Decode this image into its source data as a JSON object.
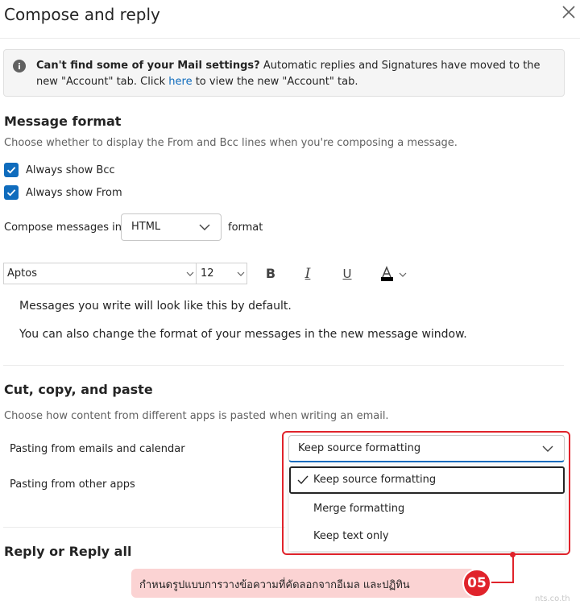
{
  "panel": {
    "title": "Compose and reply",
    "close_icon": "close-icon"
  },
  "info_bar": {
    "bold": "Can't find some of your Mail settings?",
    "text1": " Automatic replies and Signatures have moved to the new \"Account\" tab. Click ",
    "link": "here",
    "text2": " to view the new \"Account\" tab."
  },
  "message_format": {
    "heading": "Message format",
    "description": "Choose whether to display the From and Bcc lines when you're composing a message.",
    "always_bcc": {
      "label": "Always show Bcc",
      "checked": true
    },
    "always_from": {
      "label": "Always show From",
      "checked": true
    },
    "compose_prefix": "Compose messages in",
    "compose_value": "HTML",
    "compose_suffix": "format",
    "font_name": "Aptos",
    "font_size": "12",
    "toolbar": {
      "bold": "B",
      "italic": "I",
      "underline": "U"
    },
    "preview_line1": "Messages you write will look like this by default.",
    "preview_line2": "You can also change the format of your messages in the new message window."
  },
  "cut_copy_paste": {
    "heading": "Cut, copy, and paste",
    "description": "Choose how content from different apps is pasted when writing an email.",
    "emails_label": "Pasting from emails and calendar",
    "emails_value": "Keep source formatting",
    "other_label": "Pasting from other apps",
    "options": [
      "Keep source formatting",
      "Merge formatting",
      "Keep text only"
    ],
    "selected_index": 0
  },
  "reply": {
    "heading": "Reply or Reply all"
  },
  "annotation": {
    "text": "กำหนดรูปแบบการวางข้อความที่คัดลอกจากอีเมล และปฏิทิน",
    "badge": "05",
    "color": "#e0232b",
    "fill": "#fbd3d3"
  },
  "watermark": "nts.co.th"
}
